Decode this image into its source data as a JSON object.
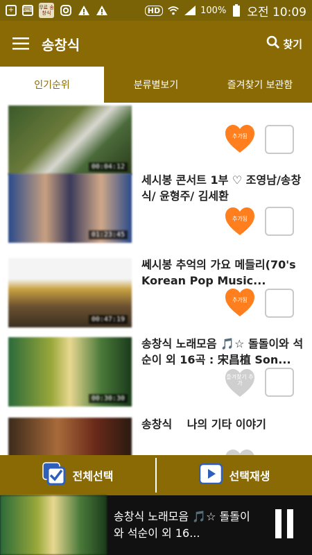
{
  "status_bar": {
    "badge_text": "무료 송창식",
    "hd": "HD",
    "battery": "100%",
    "time": "오전 10:09"
  },
  "app_bar": {
    "title": "송창식",
    "search_label": "찾기"
  },
  "tabs": [
    {
      "label": "인기순위",
      "active": true
    },
    {
      "label": "분류별보기",
      "active": false
    },
    {
      "label": "즐겨찾기 보관함",
      "active": false
    }
  ],
  "items": [
    {
      "title": "",
      "duration": "00:04:12",
      "heart_label": "추가됨",
      "heart_state": "added",
      "checked": false
    },
    {
      "title": "세시봉 콘서트 1부 ♡ 조영남/송창식/ 윤형주/ 김세환",
      "duration": "01:23:45",
      "heart_label": "추가됨",
      "heart_state": "added",
      "checked": false
    },
    {
      "title": "쎄시봉 추억의 가요 메들리(70's Korean Pop Music...",
      "duration": "00:47:19",
      "heart_label": "추가됨",
      "heart_state": "added",
      "checked": false
    },
    {
      "title": "송창식 노래모음 🎵☆ 돌돌이와 석순이 외 16곡 : 宋昌植 Son...",
      "duration": "00:30:30",
      "heart_label": "즐겨찾기 추가",
      "heart_state": "not-added",
      "checked": false
    },
    {
      "title": "송창식 　나의 기타 이야기",
      "duration": "",
      "heart_label": "",
      "heart_state": "not-added",
      "checked": false
    }
  ],
  "action_bar": {
    "select_all_label": "전체선택",
    "play_selected_label": "선택재생"
  },
  "player": {
    "title": "송창식 노래모음 🎵☆ 돌돌이와 석순이 외 16..."
  },
  "colors": {
    "brand": "#8a6a04",
    "heart_added": "#ff7f1e",
    "heart_not_added": "#cfcfcf"
  }
}
